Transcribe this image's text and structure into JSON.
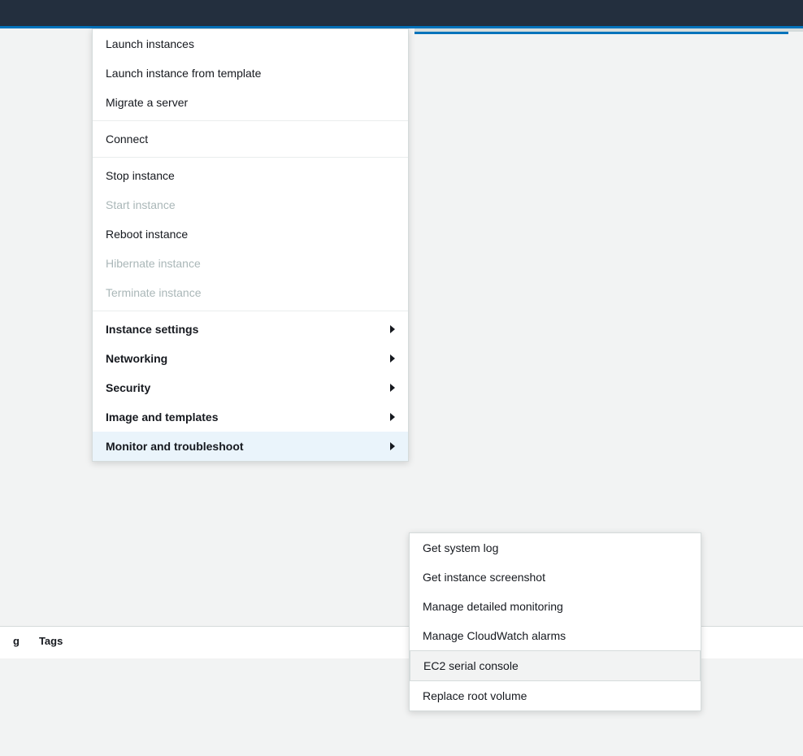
{
  "topBar": {
    "color": "#232f3e"
  },
  "primaryMenu": {
    "items": [
      {
        "id": "launch-instances",
        "label": "Launch instances",
        "disabled": false,
        "bold": false,
        "hasSubmenu": false,
        "dividerAfter": false
      },
      {
        "id": "launch-from-template",
        "label": "Launch instance from template",
        "disabled": false,
        "bold": false,
        "hasSubmenu": false,
        "dividerAfter": false
      },
      {
        "id": "migrate-server",
        "label": "Migrate a server",
        "disabled": false,
        "bold": false,
        "hasSubmenu": false,
        "dividerAfter": true
      },
      {
        "id": "connect",
        "label": "Connect",
        "disabled": false,
        "bold": false,
        "hasSubmenu": false,
        "dividerAfter": true
      },
      {
        "id": "stop-instance",
        "label": "Stop instance",
        "disabled": false,
        "bold": false,
        "hasSubmenu": false,
        "dividerAfter": false
      },
      {
        "id": "start-instance",
        "label": "Start instance",
        "disabled": true,
        "bold": false,
        "hasSubmenu": false,
        "dividerAfter": false
      },
      {
        "id": "reboot-instance",
        "label": "Reboot instance",
        "disabled": false,
        "bold": false,
        "hasSubmenu": false,
        "dividerAfter": false
      },
      {
        "id": "hibernate-instance",
        "label": "Hibernate instance",
        "disabled": true,
        "bold": false,
        "hasSubmenu": false,
        "dividerAfter": false
      },
      {
        "id": "terminate-instance",
        "label": "Terminate instance",
        "disabled": true,
        "bold": false,
        "hasSubmenu": false,
        "dividerAfter": true
      },
      {
        "id": "instance-settings",
        "label": "Instance settings",
        "disabled": false,
        "bold": true,
        "hasSubmenu": true,
        "dividerAfter": false
      },
      {
        "id": "networking",
        "label": "Networking",
        "disabled": false,
        "bold": true,
        "hasSubmenu": true,
        "dividerAfter": false
      },
      {
        "id": "security",
        "label": "Security",
        "disabled": false,
        "bold": true,
        "hasSubmenu": true,
        "dividerAfter": false
      },
      {
        "id": "image-and-templates",
        "label": "Image and templates",
        "disabled": false,
        "bold": true,
        "hasSubmenu": true,
        "dividerAfter": false
      },
      {
        "id": "monitor-and-troubleshoot",
        "label": "Monitor and troubleshoot",
        "disabled": false,
        "bold": true,
        "hasSubmenu": true,
        "active": true,
        "dividerAfter": false
      }
    ]
  },
  "submenu": {
    "items": [
      {
        "id": "get-system-log",
        "label": "Get system log",
        "highlighted": false
      },
      {
        "id": "get-instance-screenshot",
        "label": "Get instance screenshot",
        "highlighted": false
      },
      {
        "id": "manage-detailed-monitoring",
        "label": "Manage detailed monitoring",
        "highlighted": false
      },
      {
        "id": "manage-cloudwatch-alarms",
        "label": "Manage CloudWatch alarms",
        "highlighted": false
      },
      {
        "id": "ec2-serial-console",
        "label": "EC2 serial console",
        "highlighted": true
      },
      {
        "id": "replace-root-volume",
        "label": "Replace root volume",
        "highlighted": false
      }
    ]
  },
  "tagsBar": {
    "leftLabel": "g",
    "rightLabel": "Tags"
  }
}
